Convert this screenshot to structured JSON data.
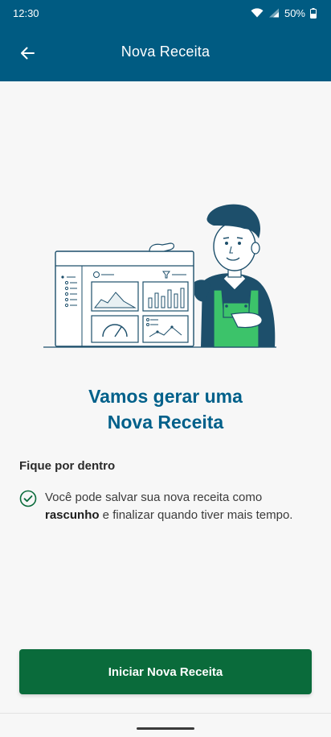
{
  "status_bar": {
    "time": "12:30",
    "battery_percent": "50%",
    "icons": [
      "wifi-icon",
      "signal-icon",
      "battery-icon"
    ]
  },
  "toolbar": {
    "back_icon": "arrow-left-icon",
    "title": "Nova Receita"
  },
  "headline": {
    "line1": "Vamos gerar uma",
    "line2": "Nova Receita"
  },
  "info": {
    "section_title": "Fique por dentro",
    "tip_icon": "check-circle-icon",
    "tip_part1": "Você pode salvar sua nova receita como ",
    "tip_bold": "rascunho",
    "tip_part2": " e finalizar quando tiver mais tempo."
  },
  "cta": {
    "label": "Iniciar Nova Receita"
  },
  "colors": {
    "app_bar": "#005b82",
    "headline": "#00608a",
    "primary_button": "#0a6b3b",
    "background": "#f7f7f7"
  }
}
